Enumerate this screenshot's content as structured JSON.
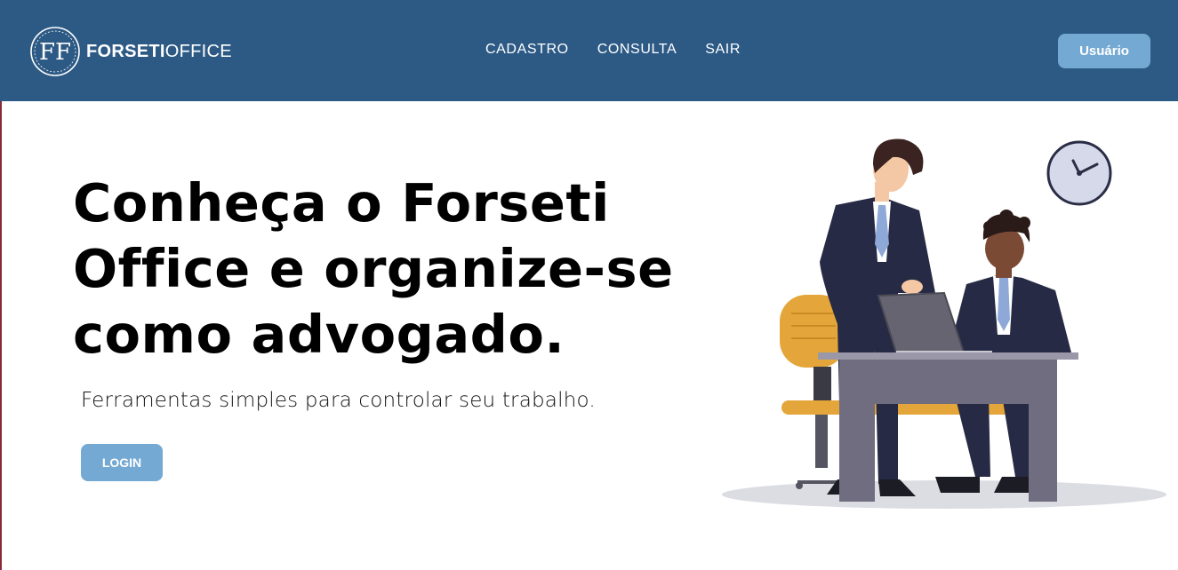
{
  "header": {
    "logo": {
      "monogram": "FF",
      "brand_bold": "FORSETI",
      "brand_light": "OFFICE"
    },
    "nav": [
      {
        "label": "CADASTRO"
      },
      {
        "label": "CONSULTA"
      },
      {
        "label": "SAIR"
      }
    ],
    "user_button": "Usuário"
  },
  "hero": {
    "title": "Conheça o Forseti Office e organize-se como advogado.",
    "subtitle": "Ferramentas simples para controlar seu trabalho.",
    "login_button": "LOGIN"
  },
  "colors": {
    "navbar": "#2d5a85",
    "button": "#74a9d3",
    "suit": "#262a44",
    "desk": "#706d80",
    "chair": "#e4a63a"
  }
}
